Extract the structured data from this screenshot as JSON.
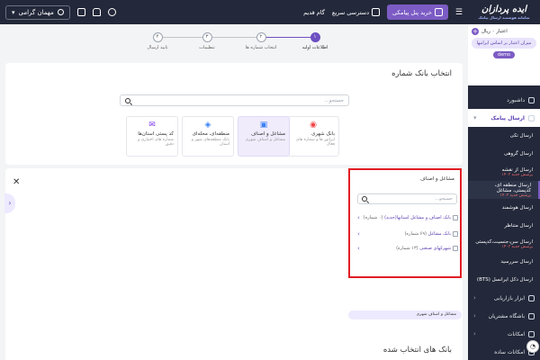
{
  "topbar": {
    "buy_panel": "خرید پنل پیامکی",
    "quick_access": "دسترسی سریع",
    "tutorial": "گام قدیم",
    "user_name": "مهمان گرامی"
  },
  "sidebar": {
    "logo": "ایده پردازان",
    "logo_sub": "سامانه هوشمند ارسال پیامک",
    "credit_label": "اعتبار ۰ ریال",
    "promo": "میزان اعتبار بر اساس ایرانیها",
    "demo": "demo",
    "items": [
      {
        "label": "داشبورد"
      },
      {
        "label": "ارسال پیامک"
      },
      {
        "label": "ابزار بازاریابی"
      },
      {
        "label": "باشگاه مشتریان"
      },
      {
        "label": "امکانات"
      },
      {
        "label": "امکانات ساده"
      }
    ],
    "subs": [
      {
        "label": "ارسال تکی",
        "note": ""
      },
      {
        "label": "ارسال گروهی",
        "note": ""
      },
      {
        "label": "ارسال از نقشه",
        "note": "پرسش جدید ۱۴۰۳"
      },
      {
        "label": "ارسال منطقه ای، کدپستی، مشاغل",
        "note": "پرسش جدید ۱۴۰۳"
      },
      {
        "label": "ارسال هوشمند",
        "note": ""
      },
      {
        "label": "ارسال متناظر",
        "note": ""
      },
      {
        "label": "ارسال سن،جنسیت،کدپستی",
        "note": "پرسش جدید ۱۴۰۳"
      },
      {
        "label": "ارسال سررسید",
        "note": ""
      },
      {
        "label": "ارسال دکل ایرانسل (BTS)",
        "note": ""
      }
    ]
  },
  "stepper": {
    "steps": [
      {
        "num": "۱",
        "label": "اطلاعات اولیه"
      },
      {
        "num": "۲",
        "label": "انتخاب شماره ها"
      },
      {
        "num": "۳",
        "label": "تنظیمات"
      },
      {
        "num": "۴",
        "label": "تایید ارسال"
      }
    ]
  },
  "bank_card": {
    "title": "انتخاب بانک شماره",
    "search_placeholder": "جستجو...",
    "tiles": [
      {
        "title": "بانک شهری",
        "sub": "اپراتور ها و شماره های فعال"
      },
      {
        "title": "مشاغل و اصناف",
        "sub": "مشاغل و اصناف شهری"
      },
      {
        "title": "منطقه‌ای، محله‌ای",
        "sub": "بانک منطقه‌های شهر و استان"
      },
      {
        "title": "کد پستی استان‌ها",
        "sub": "شماره های اختیاری و دقیق"
      }
    ]
  },
  "guild_panel": {
    "title": "مشاغل و اصناف",
    "search_placeholder": "جستجو...",
    "items": [
      {
        "label": "بانک اصناف و مشاغل استانها(جدید)",
        "count": "(۰ شماره)"
      },
      {
        "label": "بانک مشاغل",
        "count": "(۶۹ شماره)"
      },
      {
        "label": "شهرکهای صنعتی",
        "count": "(۱۳ شماره)"
      }
    ],
    "tag": "مشاغل و اصناف شهری"
  },
  "selected_card": {
    "title": "بانک های انتخاب شده"
  }
}
